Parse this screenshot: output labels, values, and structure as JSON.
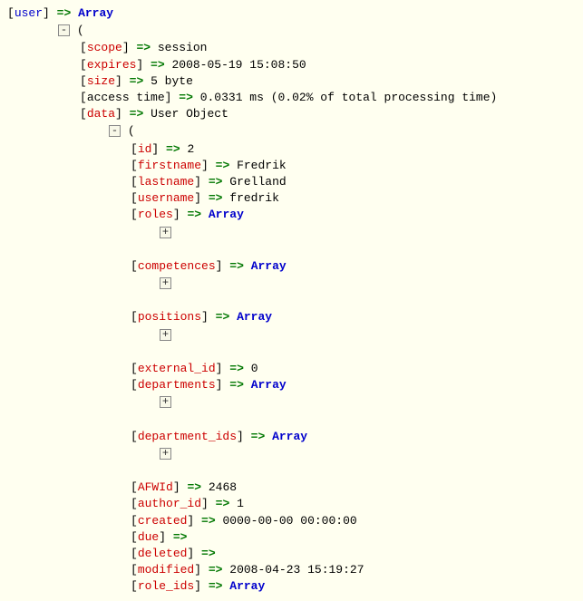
{
  "root": {
    "key": "user",
    "arrow": "=>",
    "type": "Array"
  },
  "fields": {
    "scope": {
      "key": "scope",
      "value": "session"
    },
    "expires": {
      "key": "expires",
      "value": "2008-05-19 15:08:50"
    },
    "size": {
      "key": "size",
      "value": "5 byte"
    },
    "access_time": {
      "key": "access time",
      "value": "0.0331 ms (0.02% of total processing time)"
    },
    "data": {
      "key": "data",
      "value": "User Object",
      "children": {
        "id": {
          "key": "id",
          "value": "2"
        },
        "firstname": {
          "key": "firstname",
          "value": "Fredrik"
        },
        "lastname": {
          "key": "lastname",
          "value": "Grelland"
        },
        "username": {
          "key": "username",
          "value": "fredrik"
        },
        "roles": {
          "key": "roles",
          "type": "Array"
        },
        "competences": {
          "key": "competences",
          "type": "Array"
        },
        "positions": {
          "key": "positions",
          "type": "Array"
        },
        "external_id": {
          "key": "external_id",
          "value": "0"
        },
        "departments": {
          "key": "departments",
          "type": "Array"
        },
        "department_ids": {
          "key": "department_ids",
          "type": "Array"
        },
        "AFWId": {
          "key": "AFWId",
          "value": "2468"
        },
        "author_id": {
          "key": "author_id",
          "value": "1"
        },
        "created": {
          "key": "created",
          "value": "0000-00-00 00:00:00"
        },
        "deleted": {
          "key": "deleted",
          "value": ""
        },
        "due": {
          "key": "due",
          "value": ""
        },
        "modified": {
          "key": "modified",
          "value": "2008-04-23 15:19:27"
        },
        "role_ids": {
          "key": "role_ids",
          "type": "Array"
        }
      }
    }
  },
  "symbols": {
    "open_bracket": "[",
    "close_bracket": "]",
    "open_paren": "(",
    "arrow": "=>",
    "array": "Array",
    "minus": "-",
    "plus": "+"
  }
}
